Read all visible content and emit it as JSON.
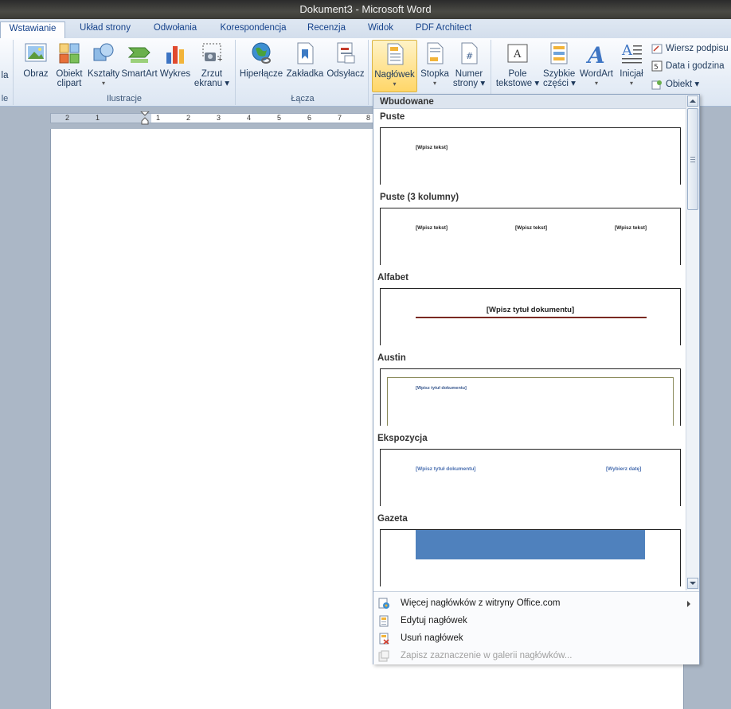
{
  "window": {
    "title": "Dokument3  -  Microsoft Word"
  },
  "tabs": [
    {
      "label": "Wstawianie",
      "active": true
    },
    {
      "label": "Układ strony"
    },
    {
      "label": "Odwołania"
    },
    {
      "label": "Korespondencja"
    },
    {
      "label": "Recenzja"
    },
    {
      "label": "Widok"
    },
    {
      "label": "PDF Architect"
    }
  ],
  "ribbon": {
    "partial_left": {
      "label": "la",
      "group": "le"
    },
    "illustrations": {
      "group_label": "Ilustracje",
      "buttons": [
        {
          "l1": "Obraz",
          "l2": ""
        },
        {
          "l1": "Obiekt",
          "l2": "clipart"
        },
        {
          "l1": "Kształty",
          "l2": "▾"
        },
        {
          "l1": "SmartArt",
          "l2": ""
        },
        {
          "l1": "Wykres",
          "l2": ""
        },
        {
          "l1": "Zrzut",
          "l2": "ekranu ▾"
        }
      ]
    },
    "links": {
      "group_label": "Łącza",
      "buttons": [
        {
          "l1": "Hiperłącze"
        },
        {
          "l1": "Zakładka"
        },
        {
          "l1": "Odsyłacz"
        }
      ]
    },
    "header_footer": {
      "buttons": [
        {
          "l1": "Nagłówek",
          "l2": "▾"
        },
        {
          "l1": "Stopka",
          "l2": "▾"
        },
        {
          "l1": "Numer",
          "l2": "strony ▾"
        }
      ]
    },
    "text": {
      "buttons": [
        {
          "l1": "Pole",
          "l2": "tekstowe ▾"
        },
        {
          "l1": "Szybkie",
          "l2": "części ▾"
        },
        {
          "l1": "WordArt",
          "l2": "▾"
        },
        {
          "l1": "Inicjał",
          "l2": "▾"
        }
      ],
      "small": [
        {
          "label": "Wiersz podpisu"
        },
        {
          "label": "Data i godzina"
        },
        {
          "label": "Obiekt ▾"
        }
      ]
    }
  },
  "ruler": {
    "numbers": [
      "2",
      "1",
      "1",
      "2",
      "3",
      "4",
      "5",
      "6",
      "7",
      "8"
    ]
  },
  "dropdown": {
    "header": "Wbudowane",
    "items": [
      {
        "name": "Puste",
        "texts": [
          "[Wpisz tekst]"
        ]
      },
      {
        "name": "Puste (3 kolumny)",
        "texts": [
          "[Wpisz tekst]",
          "[Wpisz tekst]",
          "[Wpisz tekst]"
        ]
      },
      {
        "name": "Alfabet",
        "texts": [
          "[Wpisz tytuł dokumentu]"
        ]
      },
      {
        "name": "Austin",
        "texts": [
          "[Wpisz tytuł dokumentu]"
        ]
      },
      {
        "name": "Ekspozycja",
        "texts": [
          "[Wpisz tytuł dokumentu]",
          "[Wybierz datę]"
        ]
      },
      {
        "name": "Gazeta",
        "texts": []
      }
    ],
    "menu": [
      {
        "label": "Więcej nagłówków z witryny Office.com",
        "enabled": true
      },
      {
        "label": "Edytuj nagłówek",
        "enabled": true
      },
      {
        "label": "Usuń nagłówek",
        "enabled": true
      },
      {
        "label": "Zapisz zaznaczenie w galerii nagłówków...",
        "enabled": false
      }
    ]
  },
  "colors": {
    "accent_selected": "#ffd668",
    "alfabet_rule": "#7a2a22",
    "austin_border": "#8a8a5a",
    "ekspozycja_text": "#4a6fb0",
    "gazeta_band": "#4f81bd"
  }
}
